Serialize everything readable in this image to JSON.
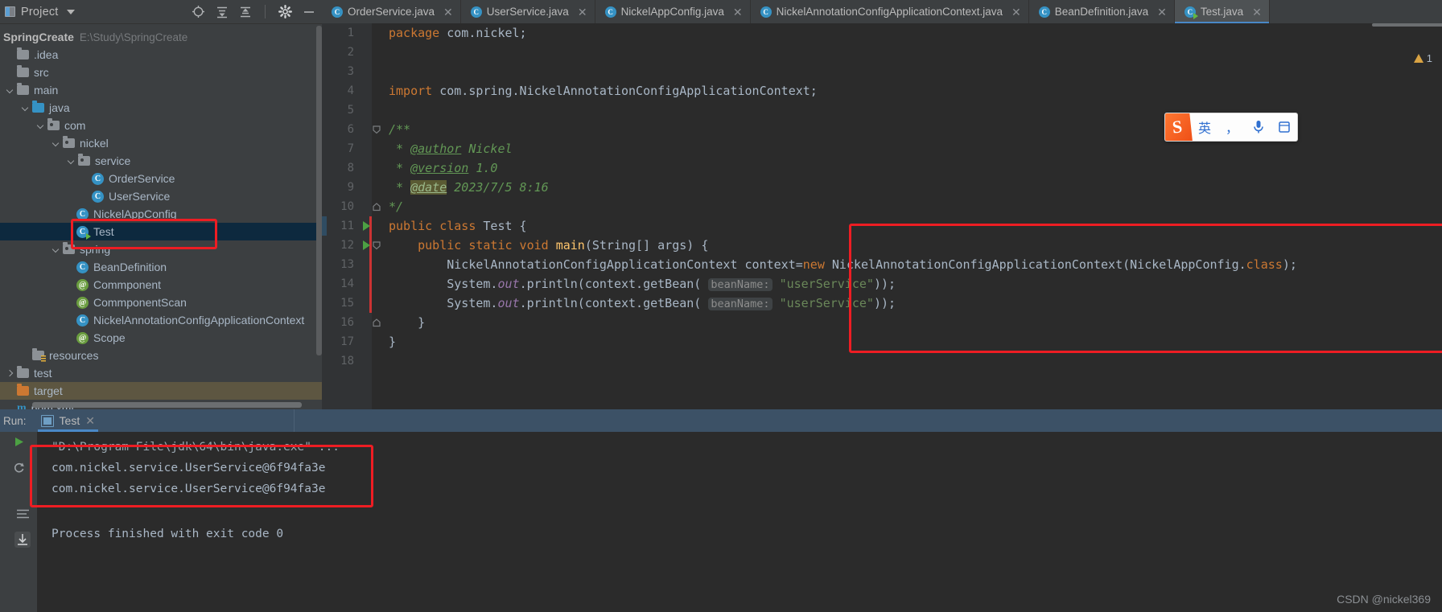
{
  "project_panel": {
    "title": "Project",
    "icons": [
      "locate-icon",
      "expand-all-icon",
      "collapse-all-icon",
      "gear-icon",
      "minimize-icon"
    ],
    "root": {
      "name": "SpringCreate",
      "path": "E:\\Study\\SpringCreate"
    },
    "tree": [
      {
        "label": ".idea",
        "icon": "folder-icon",
        "indent": 1,
        "arrow": "none"
      },
      {
        "label": "src",
        "icon": "folder-icon",
        "indent": 1,
        "arrow": "none"
      },
      {
        "label": "main",
        "icon": "folder-icon",
        "indent": 1,
        "arrow": "expanded"
      },
      {
        "label": "java",
        "icon": "folder-blue-icon",
        "indent": 2,
        "arrow": "expanded"
      },
      {
        "label": "com",
        "icon": "package-icon",
        "indent": 3,
        "arrow": "expanded"
      },
      {
        "label": "nickel",
        "icon": "package-icon",
        "indent": 4,
        "arrow": "expanded"
      },
      {
        "label": "service",
        "icon": "package-icon",
        "indent": 5,
        "arrow": "expanded"
      },
      {
        "label": "OrderService",
        "icon": "class-icon",
        "indent": 6,
        "arrow": "none"
      },
      {
        "label": "UserService",
        "icon": "class-icon",
        "indent": 6,
        "arrow": "none"
      },
      {
        "label": "NickelAppConfig",
        "icon": "class-icon",
        "indent": 5,
        "arrow": "none"
      },
      {
        "label": "Test",
        "icon": "class-runnable-icon",
        "indent": 5,
        "arrow": "none",
        "selected": true,
        "highlight": "red-box"
      },
      {
        "label": "spring",
        "icon": "package-icon",
        "indent": 4,
        "arrow": "expanded"
      },
      {
        "label": "BeanDefinition",
        "icon": "class-icon",
        "indent": 5,
        "arrow": "none"
      },
      {
        "label": "Commponent",
        "icon": "annotation-icon",
        "indent": 5,
        "arrow": "none"
      },
      {
        "label": "CommponentScan",
        "icon": "annotation-icon",
        "indent": 5,
        "arrow": "none"
      },
      {
        "label": "NickelAnnotationConfigApplicationContext",
        "icon": "class-icon",
        "indent": 5,
        "arrow": "none"
      },
      {
        "label": "Scope",
        "icon": "annotation-icon",
        "indent": 5,
        "arrow": "none"
      },
      {
        "label": "resources",
        "icon": "resources-folder-icon",
        "indent": 2,
        "arrow": "none"
      },
      {
        "label": "test",
        "icon": "folder-icon",
        "indent": 1,
        "arrow": "collapsed"
      },
      {
        "label": "target",
        "icon": "folder-orange-icon",
        "indent": 1,
        "arrow": "none",
        "row_highlight": true
      },
      {
        "label": "pom.xml",
        "icon": "maven-icon",
        "indent": 1,
        "arrow": "none"
      }
    ]
  },
  "editor": {
    "tabs": [
      {
        "label": "OrderService.java",
        "icon": "class-icon",
        "active": false
      },
      {
        "label": "UserService.java",
        "icon": "class-icon",
        "active": false
      },
      {
        "label": "NickelAppConfig.java",
        "icon": "class-icon",
        "active": false
      },
      {
        "label": "NickelAnnotationConfigApplicationContext.java",
        "icon": "class-icon",
        "active": false
      },
      {
        "label": "BeanDefinition.java",
        "icon": "class-icon",
        "active": false
      },
      {
        "label": "Test.java",
        "icon": "class-runnable-icon",
        "active": true
      }
    ],
    "warning_count": "1",
    "line_numbers": [
      "1",
      "2",
      "3",
      "4",
      "5",
      "6",
      "7",
      "8",
      "9",
      "10",
      "11",
      "12",
      "13",
      "14",
      "15",
      "16",
      "17",
      "18"
    ],
    "code": {
      "l1_kw": "package",
      "l1_rest": " com.nickel;",
      "l4_kw": "import",
      "l4_rest": " com.spring.NickelAnnotationConfigApplicationContext;",
      "l6": "/**",
      "l7_tag": "@author",
      "l7_rest": " Nickel",
      "l8_tag": "@version",
      "l8_rest": " 1.0",
      "l9_tag": "@date",
      "l9_rest": " 2023/7/5 8:16",
      "l10": "*/",
      "l11_kw": "public class ",
      "l11_name": "Test {",
      "l12_kw1": "public static void ",
      "l12_mth": "main",
      "l12_rest": "(String[] args) {",
      "l13_type": "NickelAnnotationConfigApplicationContext context=",
      "l13_new": "new",
      "l13_rest": " NickelAnnotationConfigApplicationContext(NickelAppConfig.",
      "l13_kw2": "class",
      "l13_end": ");",
      "l14_pre": "System.",
      "l14_out": "out",
      "l14_mid": ".println(context.getBean( ",
      "l14_hint": "beanName:",
      "l14_str": "\"userService\"",
      "l14_end": "));",
      "l15_pre": "System.",
      "l15_out": "out",
      "l15_mid": ".println(context.getBean( ",
      "l15_hint": "beanName:",
      "l15_str": "\"userService\"",
      "l15_end": "));",
      "l16": "}",
      "l17": "}"
    }
  },
  "run_panel": {
    "label": "Run:",
    "tab_label": "Test",
    "tab_icon": "run-config-icon",
    "sidebar_icons": [
      "rerun-icon",
      "stop-icon",
      "scroll-up-icon",
      "scroll-down-icon",
      "soft-wrap-icon",
      "export-icon"
    ],
    "console": {
      "command_line": "\"D:\\Program File\\jdk\\64\\bin\\java.exe\" ...",
      "output_lines": [
        "com.nickel.service.UserService@6f94fa3e",
        "com.nickel.service.UserService@6f94fa3e"
      ],
      "exit_line": "Process finished with exit code 0"
    },
    "watermark": "CSDN @nickel369"
  },
  "ime_widget": {
    "logo": "S",
    "mode": "英",
    "punctuation": "，",
    "mic": "mic-icon",
    "extra": "tools-icon"
  },
  "colors": {
    "accent": "#4a88c7",
    "annotation_red": "#ee1d23",
    "keyword_orange": "#cc7832",
    "string_green": "#6a8759",
    "comment_green": "#629755",
    "class_blue": "#3592c4",
    "annotation_green": "#6a9d3f"
  }
}
